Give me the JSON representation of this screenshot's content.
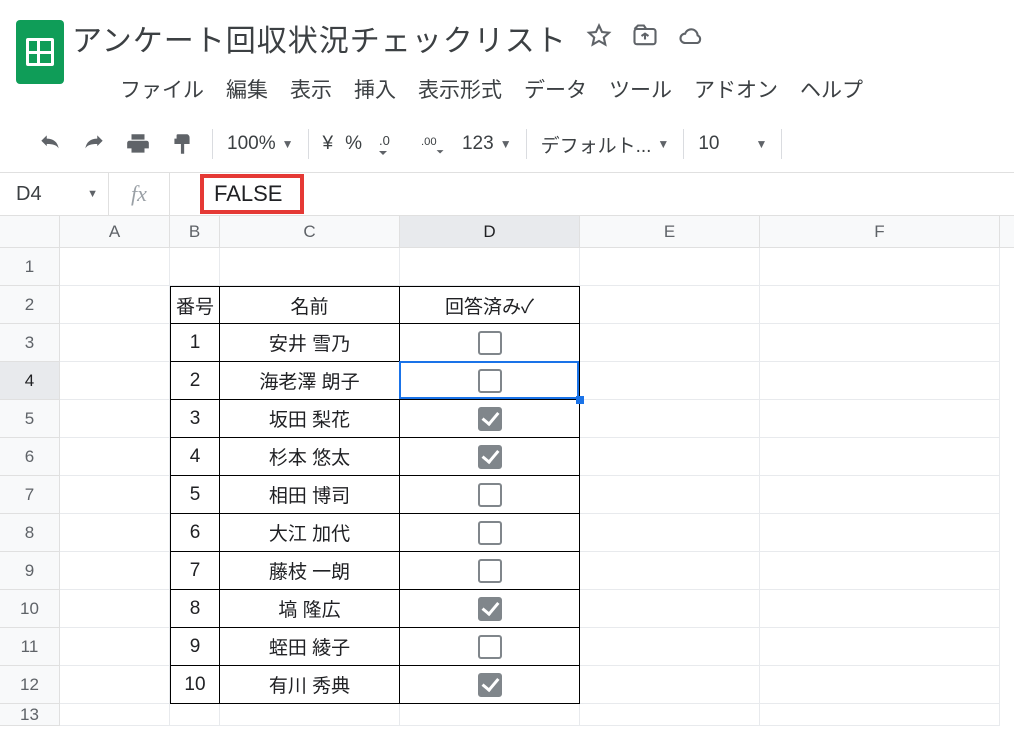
{
  "doc": {
    "title": "アンケート回収状況チェックリスト"
  },
  "menu": {
    "file": "ファイル",
    "edit": "編集",
    "view": "表示",
    "insert": "挿入",
    "format": "表示形式",
    "data": "データ",
    "tools": "ツール",
    "addons": "アドオン",
    "help": "ヘルプ"
  },
  "toolbar": {
    "zoom": "100%",
    "currency": "¥",
    "percent": "%",
    "dec_less": ".0",
    "dec_more": ".00",
    "numfmt": "123",
    "font": "デフォルト...",
    "fontsize": "10"
  },
  "fx": {
    "namebox": "D4",
    "label": "fx",
    "value": "FALSE"
  },
  "columns": [
    "A",
    "B",
    "C",
    "D",
    "E",
    "F"
  ],
  "row_headers": [
    "1",
    "2",
    "3",
    "4",
    "5",
    "6",
    "7",
    "8",
    "9",
    "10",
    "11",
    "12",
    "13"
  ],
  "table": {
    "header": {
      "num": "番号",
      "name": "名前",
      "answered": "回答済み✓"
    },
    "rows": [
      {
        "num": "1",
        "name": "安井 雪乃",
        "checked": false
      },
      {
        "num": "2",
        "name": "海老澤 朗子",
        "checked": false
      },
      {
        "num": "3",
        "name": "坂田 梨花",
        "checked": true
      },
      {
        "num": "4",
        "name": "杉本 悠太",
        "checked": true
      },
      {
        "num": "5",
        "name": "相田 博司",
        "checked": false
      },
      {
        "num": "6",
        "name": "大江 加代",
        "checked": false
      },
      {
        "num": "7",
        "name": "藤枝 一朗",
        "checked": false
      },
      {
        "num": "8",
        "name": "塙 隆広",
        "checked": true
      },
      {
        "num": "9",
        "name": "蛭田 綾子",
        "checked": false
      },
      {
        "num": "10",
        "name": "有川 秀典",
        "checked": true
      }
    ]
  },
  "active_cell": {
    "ref": "D4",
    "row": 4,
    "col": "D"
  }
}
